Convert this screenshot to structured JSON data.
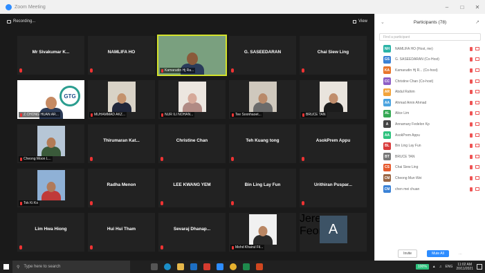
{
  "window": {
    "title": "Zoom Meeting"
  },
  "topbar": {
    "recording": "Recording...",
    "view": "View"
  },
  "tiles": [
    {
      "name": "Mr Sivakumar K...",
      "type": "name"
    },
    {
      "name": "NAMLIFA HO",
      "type": "name"
    },
    {
      "name": "Kamarudin Hj Ra...",
      "type": "video",
      "active": true
    },
    {
      "name": "G. SASEEDARAN",
      "type": "name"
    },
    {
      "name": "Chai Siew Ling",
      "type": "name"
    },
    {
      "name": "Z.CHONG HUAN AR...",
      "type": "video"
    },
    {
      "name": "MUHAMMAD AKZ...",
      "type": "video"
    },
    {
      "name": "NUR ILI NOHAN...",
      "type": "video"
    },
    {
      "name": "Tee Soonhaoet...",
      "type": "video"
    },
    {
      "name": "BRUCE TAN",
      "type": "video"
    },
    {
      "name": "Cheong Moon L...",
      "type": "video"
    },
    {
      "name": "Thirumaran Kat...",
      "type": "name"
    },
    {
      "name": "Christine Chan",
      "type": "name"
    },
    {
      "name": "Teh Kuang tong",
      "type": "name"
    },
    {
      "name": "AsokPrem Appu",
      "type": "name"
    },
    {
      "name": "Tok Ki Ko",
      "type": "video"
    },
    {
      "name": "Radha Menon",
      "type": "name"
    },
    {
      "name": "LEE KWANG YEM",
      "type": "name"
    },
    {
      "name": "Bin Ling Lay Fun",
      "type": "name"
    },
    {
      "name": "Urithiran Puspar...",
      "type": "name"
    },
    {
      "name": "Lim Hwa Hiong",
      "type": "name"
    },
    {
      "name": "Hui Hui Tham",
      "type": "name"
    },
    {
      "name": "Sevaraj Dhanap...",
      "type": "name"
    },
    {
      "name": "Mohd Khairul Fil...",
      "type": "video"
    },
    {
      "name": "Jeremy Feon...",
      "type": "avatar",
      "letter": "A"
    }
  ],
  "participants": {
    "title": "Participants (78)",
    "search_placeholder": "Find a participant",
    "items": [
      {
        "initials": "NH",
        "color": "#2ab3a6",
        "name": "NAMLIFA HO (Host, me)"
      },
      {
        "initials": "GS",
        "color": "#3b82d6",
        "name": "G. SASEEDARAN (Co-Host)"
      },
      {
        "initials": "KA",
        "color": "#e8762c",
        "name": "Kamarudin Hj R... (Co-host)"
      },
      {
        "initials": "CC",
        "color": "#8d5ec6",
        "name": "Christine Chan (Co-host)"
      },
      {
        "initials": "AR",
        "color": "#f2a33a",
        "name": "Abdul Rahim"
      },
      {
        "initials": "AA",
        "color": "#4aa3df",
        "name": "Ahmad Amin Ahmad"
      },
      {
        "initials": "AL",
        "color": "#34a853",
        "name": "Alice Lim"
      },
      {
        "initials": "A",
        "color": "#444444",
        "name": "Annamary Fedelon Kp"
      },
      {
        "initials": "AA",
        "color": "#2ec27e",
        "name": "AsokPrem Appu"
      },
      {
        "initials": "BL",
        "color": "#d93a3a",
        "name": "Bin Ling Lay Fun"
      },
      {
        "initials": "BT",
        "color": "#777777",
        "name": "BRUCE TAN"
      },
      {
        "initials": "CS",
        "color": "#e65a2e",
        "name": "Chai Siew Ling"
      },
      {
        "initials": "CM",
        "color": "#996644",
        "name": "Cheong Mun Wei"
      },
      {
        "initials": "CM",
        "color": "#3b82d6",
        "name": "chen mei chuan"
      }
    ],
    "invite_label": "Invite",
    "mute_all_label": "Mute All"
  },
  "taskbar": {
    "search_placeholder": "Type here to search",
    "battery": "100%",
    "lang": "ENG",
    "time": "11:02 AM",
    "date": "20/11/2021"
  }
}
